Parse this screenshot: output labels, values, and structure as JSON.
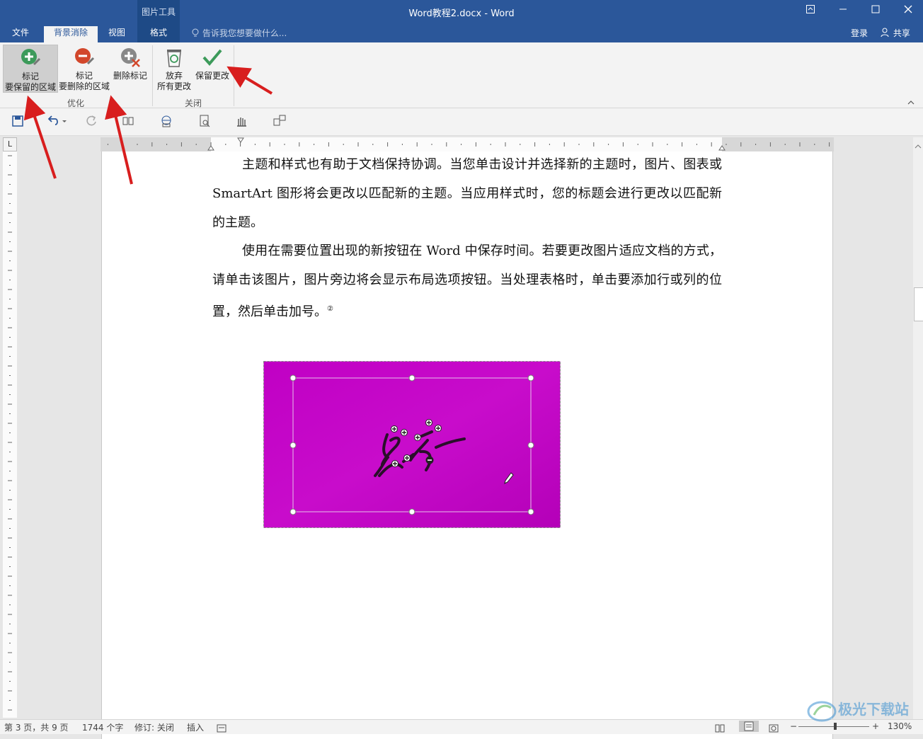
{
  "titlebar": {
    "context_group": "图片工具",
    "doc_title": "Word教程2.docx - Word",
    "tabs": [
      "文件",
      "背景消除",
      "视图",
      "格式"
    ],
    "tellme": "告诉我您想要做什么...",
    "login": "登录",
    "share": "共享"
  },
  "ribbon": {
    "buttons": {
      "mark_keep": [
        "标记",
        "要保留的区域"
      ],
      "mark_remove": [
        "标记",
        "要删除的区域"
      ],
      "delete_mark": "删除标记",
      "discard": [
        "放弃",
        "所有更改"
      ],
      "keep_changes": "保留更改"
    },
    "groups": [
      "优化",
      "关闭"
    ]
  },
  "ruler": {
    "corner": "L"
  },
  "document": {
    "para1": "主题和样式也有助于文档保持协调。当您单击设计并选择新的主题时，图片、图表或 SmartArt 图形将会更改以匹配新的主题。当应用样式时，您的标题会进行更改以匹配新的主题。",
    "para2": "使用在需要位置出现的新按钮在 Word 中保存时间。若要更改图片适应文档的方式，请单击该图片，图片旁边将会显示布局选项按钮。当处理表格时，单击要添加行或列的位置，然后单击加号。",
    "footnote_mark": "②"
  },
  "status": {
    "page": "第 3 页，共 9 页",
    "words": "1744 个字",
    "revision": "修订: 关闭",
    "mode": "插入",
    "zoom": "130%"
  },
  "watermark": "极光下载站",
  "colors": {
    "titlebar": "#2b579a",
    "image_fill": "#c100c1",
    "arrow": "#d81e1e",
    "keep_green": "#3c9a5a",
    "remove_red": "#d2472b"
  }
}
